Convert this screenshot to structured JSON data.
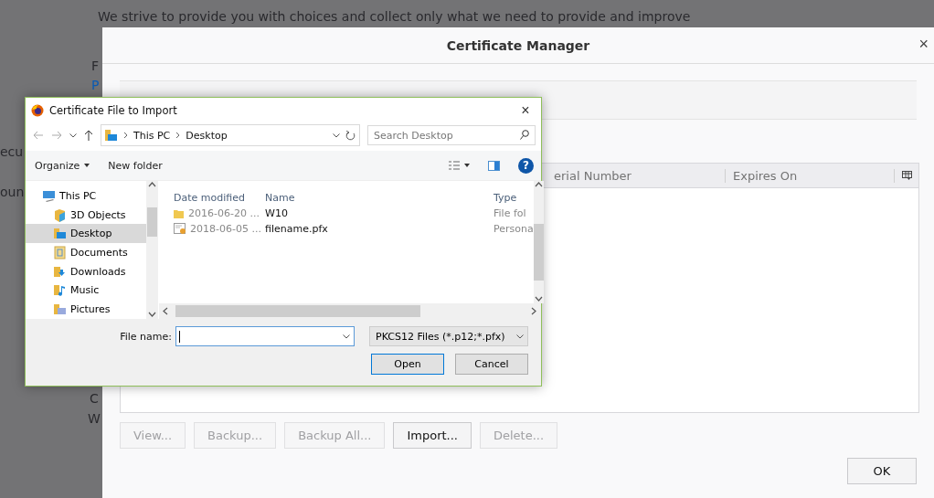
{
  "background": {
    "sentence": "We strive to provide you with choices and collect only what we need to provide and improve",
    "fragments": [
      "F",
      "P",
      "ecu",
      "oun",
      "C",
      "W"
    ]
  },
  "certificate_manager": {
    "title": "Certificate Manager",
    "close": "×",
    "table": {
      "columns": [
        "erial Number",
        "Expires On"
      ]
    },
    "buttons": [
      {
        "label": "View...",
        "disabled": true
      },
      {
        "label": "Backup...",
        "disabled": true
      },
      {
        "label": "Backup All...",
        "disabled": true
      },
      {
        "label": "Import...",
        "disabled": false
      },
      {
        "label": "Delete...",
        "disabled": true
      }
    ],
    "ok": "OK"
  },
  "file_dialog": {
    "title": "Certificate File to Import",
    "close": "×",
    "breadcrumb": [
      "This PC",
      "Desktop"
    ],
    "search": {
      "placeholder": "Search Desktop"
    },
    "toolbar": {
      "organize": "Organize",
      "new_folder": "New folder",
      "help": "?"
    },
    "navigation": [
      {
        "label": "This PC",
        "kind": "pc",
        "selected": false,
        "children": [
          {
            "label": "3D Objects",
            "kind": "objects",
            "selected": false
          },
          {
            "label": "Desktop",
            "kind": "desktop",
            "selected": true
          },
          {
            "label": "Documents",
            "kind": "documents",
            "selected": false
          },
          {
            "label": "Downloads",
            "kind": "downloads",
            "selected": false
          },
          {
            "label": "Music",
            "kind": "music",
            "selected": false
          },
          {
            "label": "Pictures",
            "kind": "pictures",
            "selected": false
          }
        ]
      }
    ],
    "columns": [
      "Date modified",
      "Name",
      "Type"
    ],
    "files": [
      {
        "kind": "folder",
        "date": "2016-06-20 ...",
        "name": "W10",
        "type": "File fol"
      },
      {
        "kind": "certificate",
        "date": "2018-06-05 ...",
        "name": "filename.pfx",
        "type": "Persona"
      }
    ],
    "file_name_label": "File name:",
    "filter": "PKCS12 Files (*.p12;*.pfx)",
    "open": "Open",
    "cancel": "Cancel"
  }
}
